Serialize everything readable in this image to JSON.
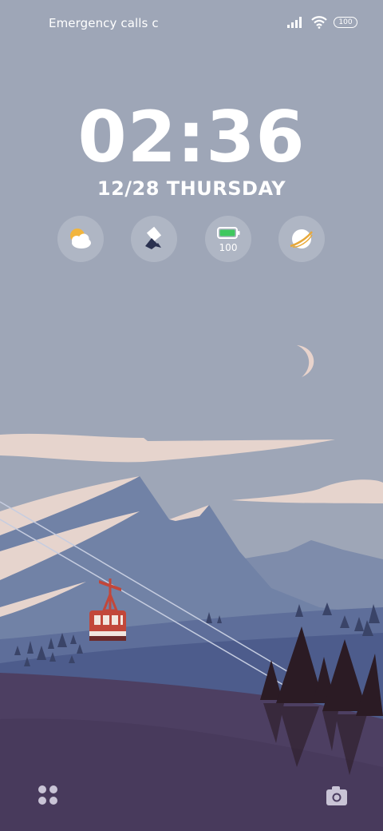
{
  "status_bar": {
    "carrier_text": "Emergency calls c",
    "battery_level": "100",
    "icons": [
      "signal-icon",
      "wifi-icon",
      "battery-icon"
    ]
  },
  "lock_screen": {
    "time": "02:36",
    "date": "12/28 THURSDAY"
  },
  "widgets": [
    {
      "name": "weather-widget",
      "icon": "partly-cloudy-icon"
    },
    {
      "name": "cleaner-widget",
      "icon": "broom-icon"
    },
    {
      "name": "battery-widget",
      "icon": "battery-icon",
      "value": "100"
    },
    {
      "name": "planet-widget",
      "icon": "planet-icon"
    }
  ],
  "shortcuts": {
    "left": "apps-icon",
    "right": "camera-icon"
  },
  "colors": {
    "sky": "#9ea6b7",
    "clock_text": "#ffffff",
    "gondola": "#c2473a",
    "battery_green": "#3fc85f"
  }
}
